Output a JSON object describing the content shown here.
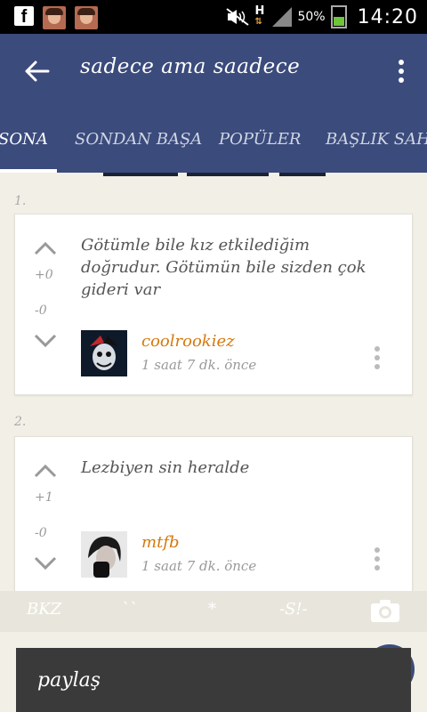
{
  "status_bar": {
    "battery": "50%",
    "time": "14:20",
    "network": "H"
  },
  "app_bar": {
    "title": "sadece ama saadece",
    "tabs": [
      {
        "label": "SONA"
      },
      {
        "label": "SONDAN BAŞA"
      },
      {
        "label": "POPÜLER"
      },
      {
        "label": "BAŞLIK SAH"
      }
    ]
  },
  "entries": [
    {
      "number": "1.",
      "text": "Götümle bile kız etkilediğim doğrudur. Götümün bile sizden çok gideri var",
      "plus": "+0",
      "minus": "-0",
      "author": "coolrookiez",
      "time": "1 saat 7 dk. önce"
    },
    {
      "number": "2.",
      "text": "Lezbiyen sin heralde",
      "plus": "+1",
      "minus": "-0",
      "author": "mtfb",
      "time": "1 saat 7 dk. önce"
    }
  ],
  "toolbar": {
    "bkz": "BKZ",
    "quote": "``",
    "star": "*",
    "spoiler": "-S!-"
  },
  "compose": {
    "placeholder": "paylaş"
  },
  "colors": {
    "app_bar": "#3b4b7c",
    "author": "#d4790e",
    "background": "#f1efe6"
  }
}
